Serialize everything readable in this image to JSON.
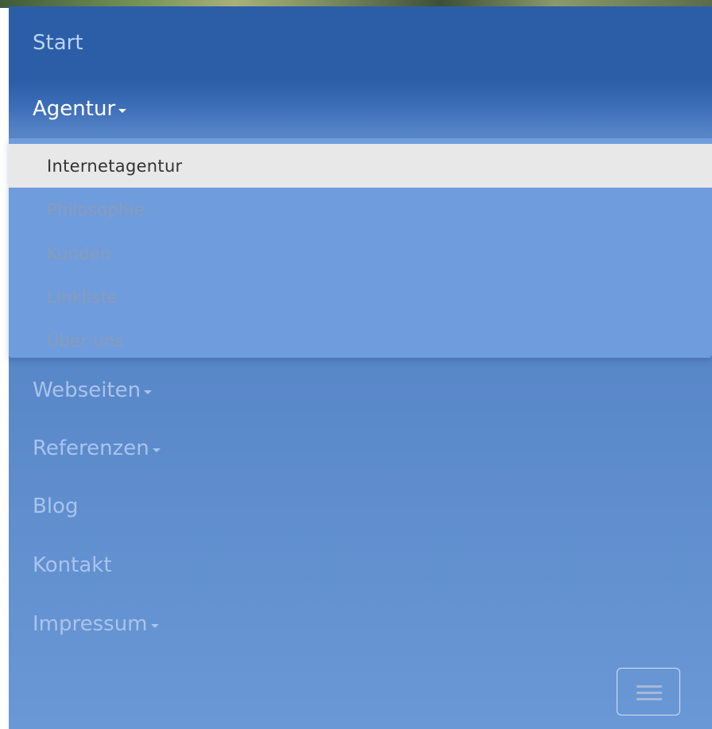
{
  "nav": {
    "items": [
      {
        "label": "Start"
      },
      {
        "label": "Agentur",
        "dropdown": true,
        "open": true
      },
      {
        "label": "Webseiten",
        "dropdown": true
      },
      {
        "label": "Referenzen",
        "dropdown": true
      },
      {
        "label": "Blog"
      },
      {
        "label": "Kontakt"
      },
      {
        "label": "Impressum",
        "dropdown": true
      }
    ],
    "submenu": [
      {
        "label": "Internetagentur",
        "active": true
      },
      {
        "label": "Philosophie"
      },
      {
        "label": "Kunden"
      },
      {
        "label": "Linkliste"
      },
      {
        "label": "Über uns"
      }
    ]
  },
  "icons": {
    "caret": "caret-down-icon",
    "toggle": "hamburger-menu-icon"
  },
  "colors": {
    "nav_background": "#5584c6",
    "active_item_bg": "#2c5ea8",
    "dropdown_bg": "#6f9cdc",
    "active_submenu_bg": "#e8e8e8"
  }
}
